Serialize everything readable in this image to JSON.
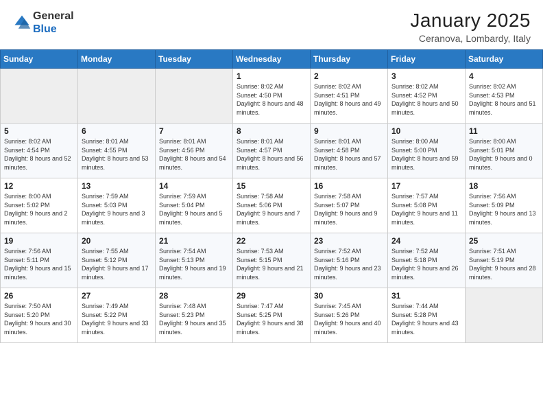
{
  "header": {
    "logo_line1": "General",
    "logo_line2": "Blue",
    "month": "January 2025",
    "location": "Ceranova, Lombardy, Italy"
  },
  "days_of_week": [
    "Sunday",
    "Monday",
    "Tuesday",
    "Wednesday",
    "Thursday",
    "Friday",
    "Saturday"
  ],
  "weeks": [
    [
      {
        "day": "",
        "empty": true
      },
      {
        "day": "",
        "empty": true
      },
      {
        "day": "",
        "empty": true
      },
      {
        "day": "1",
        "sunrise": "8:02 AM",
        "sunset": "4:50 PM",
        "daylight": "8 hours and 48 minutes."
      },
      {
        "day": "2",
        "sunrise": "8:02 AM",
        "sunset": "4:51 PM",
        "daylight": "8 hours and 49 minutes."
      },
      {
        "day": "3",
        "sunrise": "8:02 AM",
        "sunset": "4:52 PM",
        "daylight": "8 hours and 50 minutes."
      },
      {
        "day": "4",
        "sunrise": "8:02 AM",
        "sunset": "4:53 PM",
        "daylight": "8 hours and 51 minutes."
      }
    ],
    [
      {
        "day": "5",
        "sunrise": "8:02 AM",
        "sunset": "4:54 PM",
        "daylight": "8 hours and 52 minutes."
      },
      {
        "day": "6",
        "sunrise": "8:01 AM",
        "sunset": "4:55 PM",
        "daylight": "8 hours and 53 minutes."
      },
      {
        "day": "7",
        "sunrise": "8:01 AM",
        "sunset": "4:56 PM",
        "daylight": "8 hours and 54 minutes."
      },
      {
        "day": "8",
        "sunrise": "8:01 AM",
        "sunset": "4:57 PM",
        "daylight": "8 hours and 56 minutes."
      },
      {
        "day": "9",
        "sunrise": "8:01 AM",
        "sunset": "4:58 PM",
        "daylight": "8 hours and 57 minutes."
      },
      {
        "day": "10",
        "sunrise": "8:00 AM",
        "sunset": "5:00 PM",
        "daylight": "8 hours and 59 minutes."
      },
      {
        "day": "11",
        "sunrise": "8:00 AM",
        "sunset": "5:01 PM",
        "daylight": "9 hours and 0 minutes."
      }
    ],
    [
      {
        "day": "12",
        "sunrise": "8:00 AM",
        "sunset": "5:02 PM",
        "daylight": "9 hours and 2 minutes."
      },
      {
        "day": "13",
        "sunrise": "7:59 AM",
        "sunset": "5:03 PM",
        "daylight": "9 hours and 3 minutes."
      },
      {
        "day": "14",
        "sunrise": "7:59 AM",
        "sunset": "5:04 PM",
        "daylight": "9 hours and 5 minutes."
      },
      {
        "day": "15",
        "sunrise": "7:58 AM",
        "sunset": "5:06 PM",
        "daylight": "9 hours and 7 minutes."
      },
      {
        "day": "16",
        "sunrise": "7:58 AM",
        "sunset": "5:07 PM",
        "daylight": "9 hours and 9 minutes."
      },
      {
        "day": "17",
        "sunrise": "7:57 AM",
        "sunset": "5:08 PM",
        "daylight": "9 hours and 11 minutes."
      },
      {
        "day": "18",
        "sunrise": "7:56 AM",
        "sunset": "5:09 PM",
        "daylight": "9 hours and 13 minutes."
      }
    ],
    [
      {
        "day": "19",
        "sunrise": "7:56 AM",
        "sunset": "5:11 PM",
        "daylight": "9 hours and 15 minutes."
      },
      {
        "day": "20",
        "sunrise": "7:55 AM",
        "sunset": "5:12 PM",
        "daylight": "9 hours and 17 minutes."
      },
      {
        "day": "21",
        "sunrise": "7:54 AM",
        "sunset": "5:13 PM",
        "daylight": "9 hours and 19 minutes."
      },
      {
        "day": "22",
        "sunrise": "7:53 AM",
        "sunset": "5:15 PM",
        "daylight": "9 hours and 21 minutes."
      },
      {
        "day": "23",
        "sunrise": "7:52 AM",
        "sunset": "5:16 PM",
        "daylight": "9 hours and 23 minutes."
      },
      {
        "day": "24",
        "sunrise": "7:52 AM",
        "sunset": "5:18 PM",
        "daylight": "9 hours and 26 minutes."
      },
      {
        "day": "25",
        "sunrise": "7:51 AM",
        "sunset": "5:19 PM",
        "daylight": "9 hours and 28 minutes."
      }
    ],
    [
      {
        "day": "26",
        "sunrise": "7:50 AM",
        "sunset": "5:20 PM",
        "daylight": "9 hours and 30 minutes."
      },
      {
        "day": "27",
        "sunrise": "7:49 AM",
        "sunset": "5:22 PM",
        "daylight": "9 hours and 33 minutes."
      },
      {
        "day": "28",
        "sunrise": "7:48 AM",
        "sunset": "5:23 PM",
        "daylight": "9 hours and 35 minutes."
      },
      {
        "day": "29",
        "sunrise": "7:47 AM",
        "sunset": "5:25 PM",
        "daylight": "9 hours and 38 minutes."
      },
      {
        "day": "30",
        "sunrise": "7:45 AM",
        "sunset": "5:26 PM",
        "daylight": "9 hours and 40 minutes."
      },
      {
        "day": "31",
        "sunrise": "7:44 AM",
        "sunset": "5:28 PM",
        "daylight": "9 hours and 43 minutes."
      },
      {
        "day": "",
        "empty": true
      }
    ]
  ]
}
